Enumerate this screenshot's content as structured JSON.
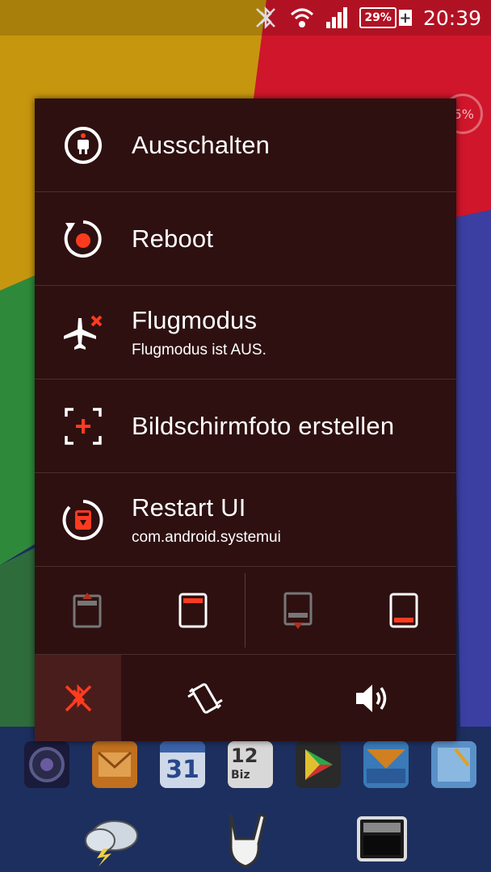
{
  "status_bar": {
    "battery_percent": "29%",
    "battery_plus": "+",
    "time": "20:39"
  },
  "background_badge": "55%",
  "power_menu": {
    "items": [
      {
        "title": "Ausschalten",
        "subtitle": ""
      },
      {
        "title": "Reboot",
        "subtitle": ""
      },
      {
        "title": "Flugmodus",
        "subtitle": "Flugmodus ist AUS."
      },
      {
        "title": "Bildschirmfoto erstellen",
        "subtitle": ""
      },
      {
        "title": "Restart UI",
        "subtitle": "com.android.systemui"
      }
    ],
    "sound_modes": [
      "silent",
      "vibrate",
      "sound"
    ],
    "active_sound_mode": "silent"
  },
  "calendar_icon": {
    "day": "31",
    "badge_number": "12",
    "badge_text": "Biz"
  },
  "icons": {
    "status": [
      "bluetooth-off-icon",
      "wifi-icon",
      "signal-icon",
      "battery-icon"
    ],
    "menu": [
      "power-icon",
      "reboot-icon",
      "airplane-icon",
      "screenshot-icon",
      "restart-ui-icon"
    ],
    "toggles": [
      "expand-top-icon",
      "screen-top-icon",
      "expand-bottom-icon",
      "screen-bottom-icon"
    ],
    "sound": [
      "silent-icon",
      "vibrate-icon",
      "volume-icon"
    ]
  },
  "colors": {
    "dialog_bg": "#2e1010",
    "accent": "#ff3b1f",
    "active_cell": "#4a1d1d"
  }
}
